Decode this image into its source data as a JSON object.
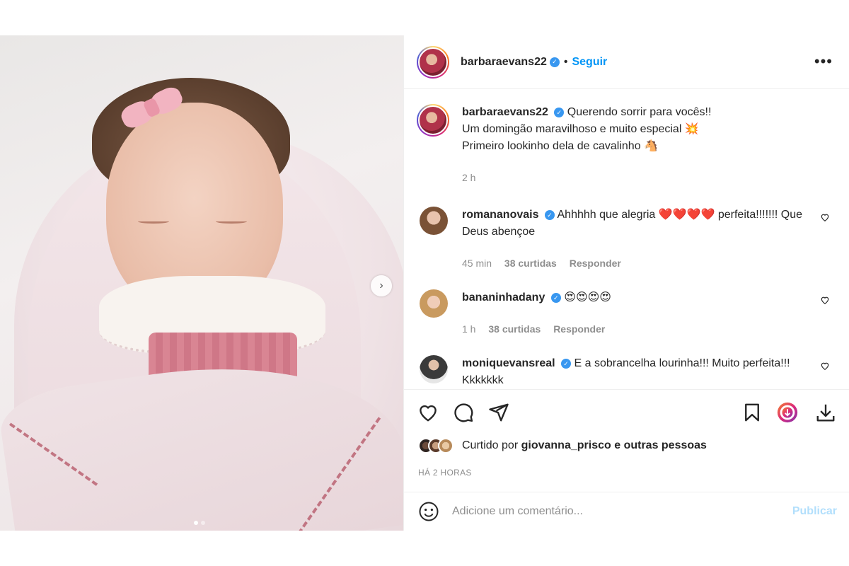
{
  "post": {
    "media": {
      "carousel_dots": 2,
      "active_dot": 0,
      "next_icon": "chevron-right-icon"
    },
    "header": {
      "username": "barbaraevans22",
      "verified": true,
      "separator": "•",
      "follow_label": "Seguir",
      "more_label": "•••"
    },
    "caption": {
      "username": "barbaraevans22",
      "lines": [
        "Querendo sorrir para vocês!!",
        "Um domingão maravilhoso e muito especial 💥",
        "Primeiro lookinho dela de cavalinho 🐴"
      ],
      "time": "2 h"
    },
    "comments": [
      {
        "username": "romananovais",
        "text": "Ahhhhh que alegria ❤️❤️❤️❤️ perfeita!!!!!!! Que Deus abençoe",
        "time": "45 min",
        "likes": "38 curtidas",
        "reply": "Responder"
      },
      {
        "username": "bananinhadany",
        "text": "😍😍😍😍",
        "time": "1 h",
        "likes": "38 curtidas",
        "reply": "Responder"
      },
      {
        "username": "moniquevansreal",
        "text": "E a sobrancelha lourinha!!! Muito perfeita!!! Kkkkkkk"
      }
    ],
    "actions": {
      "like_icon": "heart-icon",
      "comment_icon": "comment-icon",
      "share_icon": "send-icon",
      "save_icon": "bookmark-icon",
      "download_icon": "download-icon"
    },
    "likes": {
      "prefix": "Curtido por",
      "user": "giovanna_prisco",
      "suffix": "e outras pessoas"
    },
    "posted_ago": "HÁ 2 HORAS",
    "add_comment": {
      "placeholder": "Adicione um comentário...",
      "publish_label": "Publicar"
    }
  },
  "colors": {
    "accent_blue": "#0095f6",
    "verified_blue": "#3897f0",
    "muted_text": "#8e8e8e",
    "publish_disabled": "#b2dffc"
  }
}
